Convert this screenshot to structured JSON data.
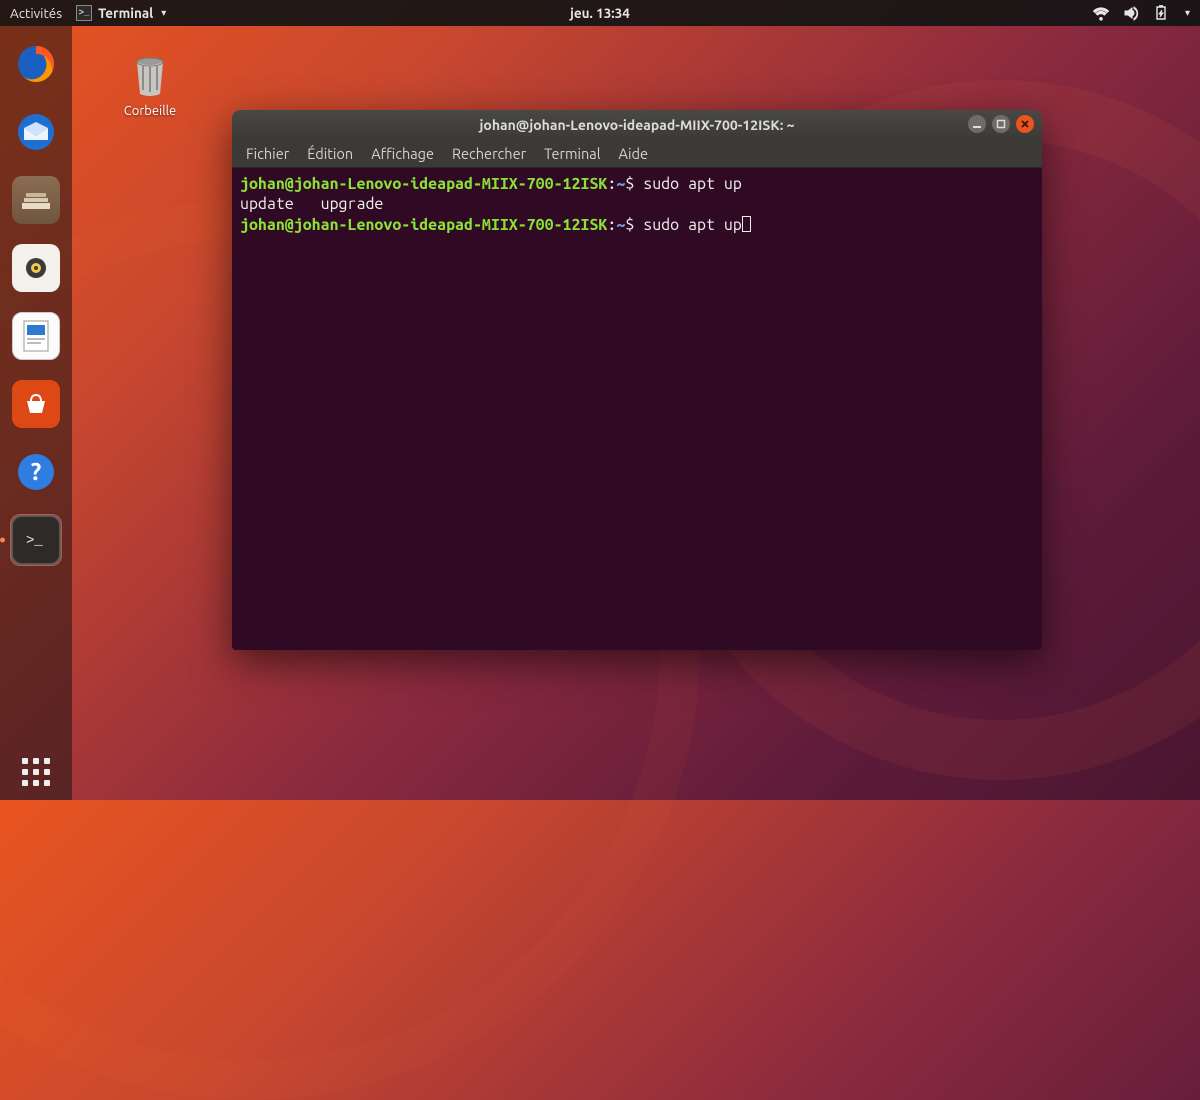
{
  "topbar": {
    "activities": "Activités",
    "app_label": "Terminal",
    "clock": "jeu. 13:34"
  },
  "desktop": {
    "trash_label": "Corbeille"
  },
  "dock": {
    "items": [
      {
        "name": "firefox"
      },
      {
        "name": "thunderbird"
      },
      {
        "name": "files"
      },
      {
        "name": "rhythmbox"
      },
      {
        "name": "libreoffice-writer"
      },
      {
        "name": "ubuntu-software"
      },
      {
        "name": "help"
      },
      {
        "name": "terminal",
        "active": true
      }
    ]
  },
  "terminal": {
    "title": "johan@johan-Lenovo-ideapad-MIIX-700-12ISK: ~",
    "menu": {
      "file": "Fichier",
      "edit": "Édition",
      "view": "Affichage",
      "search": "Rechercher",
      "terminal": "Terminal",
      "help": "Aide"
    },
    "prompt_user": "johan@johan-Lenovo-ideapad-MIIX-700-12ISK",
    "prompt_sep": ":",
    "prompt_path": "~",
    "prompt_dollar": "$",
    "lines": {
      "cmd1": " sudo apt up",
      "completion": "update   upgrade",
      "cmd2": " sudo apt up"
    }
  }
}
